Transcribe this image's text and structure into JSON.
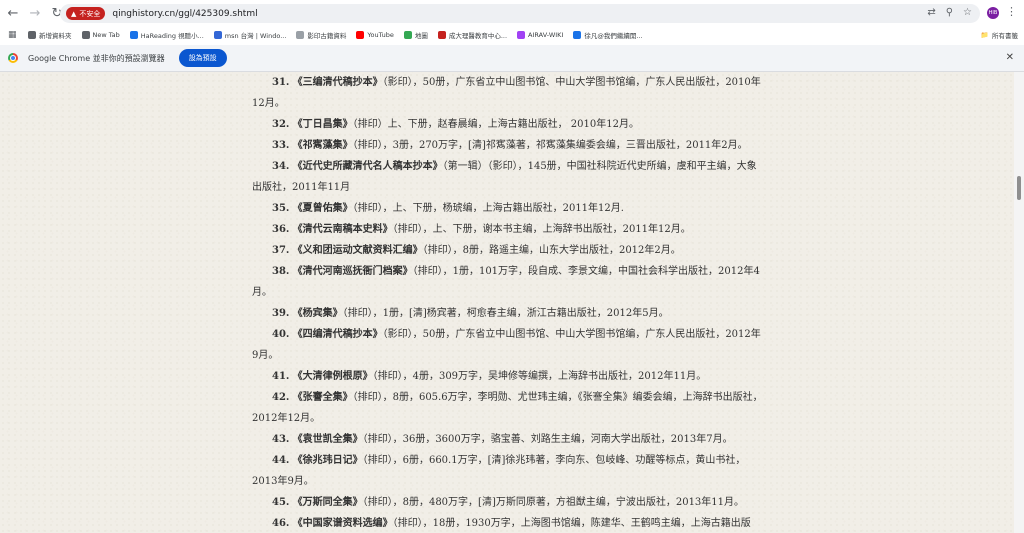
{
  "browser": {
    "security_label": "不安全",
    "url": "qinghistory.cn/ggl/425309.shtml",
    "profile_initials": "HIB"
  },
  "bookmarks": {
    "items": [
      {
        "label": "新增資料夾",
        "color": "#5f6368"
      },
      {
        "label": "New Tab",
        "color": "#5f6368"
      },
      {
        "label": "HaReading 視聽小...",
        "color": "#1a73e8"
      },
      {
        "label": "msn 台灣 | Windo...",
        "color": "#3367d6"
      },
      {
        "label": "影印古籍資料",
        "color": "#9aa0a6"
      },
      {
        "label": "YouTube",
        "color": "#ff0000"
      },
      {
        "label": "地圖",
        "color": "#34a853"
      },
      {
        "label": "成大理醫教育中心...",
        "color": "#c5221f"
      },
      {
        "label": "AIRAV-WIKI",
        "color": "#a142f4"
      },
      {
        "label": "徐凡@我們繼續開...",
        "color": "#1a73e8"
      }
    ],
    "all_label": "所有書籤"
  },
  "infobar": {
    "text": "Google Chrome 並非你的預設瀏覽器",
    "button": "設為預設"
  },
  "entries": [
    {
      "num": "31.",
      "title": "《三编清代稿抄本》",
      "rest": "（影印），50册，广东省立中山图书馆、中山大学图书馆编，广东人民出版社，2010年12月。"
    },
    {
      "num": "32.",
      "title": "《丁日昌集》",
      "rest": "（排印）上、下册，赵春晨编，上海古籍出版社， 2010年12月。"
    },
    {
      "num": "33.",
      "title": "《祁寯藻集》",
      "rest": "（排印），3册，270万字，[清]祁寯藻著，祁寯藻集编委会编，三晋出版社，2011年2月。"
    },
    {
      "num": "34.",
      "title": "《近代史所藏清代名人稿本抄本》",
      "rest": "（第一辑）（影印），145册，中国社科院近代史所编，虞和平主编，大象出版社，2011年11月"
    },
    {
      "num": "35.",
      "title": "《夏曾佑集》",
      "rest": "（排印），上、下册，杨琥编，上海古籍出版社，2011年12月."
    },
    {
      "num": "36.",
      "title": "《清代云南稿本史料》",
      "rest": "（排印），上、下册，谢本书主编，上海辞书出版社，2011年12月。"
    },
    {
      "num": "37.",
      "title": "《义和团运动文献资料汇编》",
      "rest": "（排印），8册，路遥主编，山东大学出版社，2012年2月。"
    },
    {
      "num": "38.",
      "title": "《清代河南巡抚衙门档案》",
      "rest": "（排印），1册，101万字，段自成、李景文编，中国社会科学出版社，2012年4月。"
    },
    {
      "num": "39.",
      "title": "《杨宾集》",
      "rest": "（排印），1册，[清]杨宾著，柯愈春主编，浙江古籍出版社，2012年5月。"
    },
    {
      "num": "40.",
      "title": "《四编清代稿抄本》",
      "rest": "（影印），50册，广东省立中山图书馆、中山大学图书馆编，广东人民出版社，2012年9月。"
    },
    {
      "num": "41.",
      "title": "《大清律例根原》",
      "rest": "（排印），4册，309万字，吴坤修等编撰，上海辞书出版社，2012年11月。"
    },
    {
      "num": "42.",
      "title": "《张謇全集》",
      "rest": "（排印），8册，605.6万字，李明勋、尤世玮主编，《张謇全集》编委会编，上海辞书出版社，2012年12月。"
    },
    {
      "num": "43.",
      "title": "《袁世凯全集》",
      "rest": "（排印），36册，3600万字，骆宝善、刘路生主编，河南大学出版社，2013年7月。"
    },
    {
      "num": "44.",
      "title": "《徐兆玮日记》",
      "rest": "（排印），6册，660.1万字，[清]徐兆玮著，李向东、包岐峰、功醒等标点，黄山书社，2013年9月。"
    },
    {
      "num": "45.",
      "title": "《万斯同全集》",
      "rest": "（排印），8册，480万字，[清]万斯同原著，方祖猷主编，宁波出版社，2013年11月。"
    },
    {
      "num": "46.",
      "title": "《中国家谱资料选编》",
      "rest": "（排印），18册，1930万字，上海图书馆编，陈建华、王鹤鸣主编，上海古籍出版社，"
    }
  ]
}
